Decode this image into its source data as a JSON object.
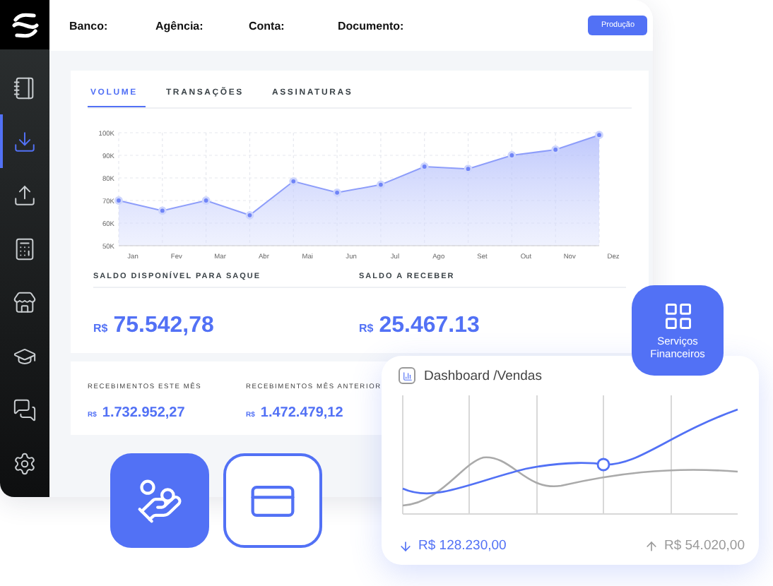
{
  "sidebar": {
    "items": [
      {
        "selected": false
      },
      {
        "selected": true
      },
      {
        "selected": false
      },
      {
        "selected": false
      },
      {
        "selected": false
      },
      {
        "selected": false
      },
      {
        "selected": false
      },
      {
        "selected": false
      }
    ]
  },
  "header": {
    "fields": [
      "Banco:",
      "Agência:",
      "Conta:",
      "Documento:"
    ],
    "button": "Produção"
  },
  "tabs": [
    {
      "label": "VOLUME",
      "selected": true
    },
    {
      "label": "TRANSAÇÕES",
      "selected": false
    },
    {
      "label": "ASSINATURAS",
      "selected": false
    }
  ],
  "chart_data": {
    "type": "area",
    "grid": true,
    "categories": [
      "Jan",
      "Fev",
      "Mar",
      "Abr",
      "Mai",
      "Jun",
      "Jul",
      "Ago",
      "Set",
      "Out",
      "Nov",
      "Dez"
    ],
    "values": [
      70000,
      65500,
      70000,
      63500,
      78500,
      73500,
      77000,
      85000,
      84000,
      90000,
      92500,
      99000
    ],
    "ylim": [
      50000,
      100000
    ],
    "yticks": [
      {
        "value": 50000,
        "label": "50K"
      },
      {
        "value": 60000,
        "label": "60K"
      },
      {
        "value": 70000,
        "label": "70K"
      },
      {
        "value": 80000,
        "label": "80K"
      },
      {
        "value": 90000,
        "label": "90K"
      },
      {
        "value": 100000,
        "label": "100K"
      }
    ]
  },
  "balances": [
    {
      "label": "SALDO DISPONÍVEL PARA SAQUE",
      "currency": "R$",
      "amount": "75.542,78"
    },
    {
      "label": "SALDO A RECEBER",
      "currency": "R$",
      "amount": "25.467.13"
    }
  ],
  "receipts": [
    {
      "label": "RECEBIMENTOS ESTE MÊS",
      "currency": "R$",
      "amount": "1.732.952,27"
    },
    {
      "label": "RECEBIMENTOS MÊS ANTERIOR",
      "currency": "R$",
      "amount": "1.472.479,12"
    }
  ],
  "services_tile": {
    "label": "Serviços Financeiros"
  },
  "sales_card": {
    "title": "Dashboard /Vendas",
    "down_value": "R$ 128.230,00",
    "up_value": "R$ 54.020,00"
  }
}
